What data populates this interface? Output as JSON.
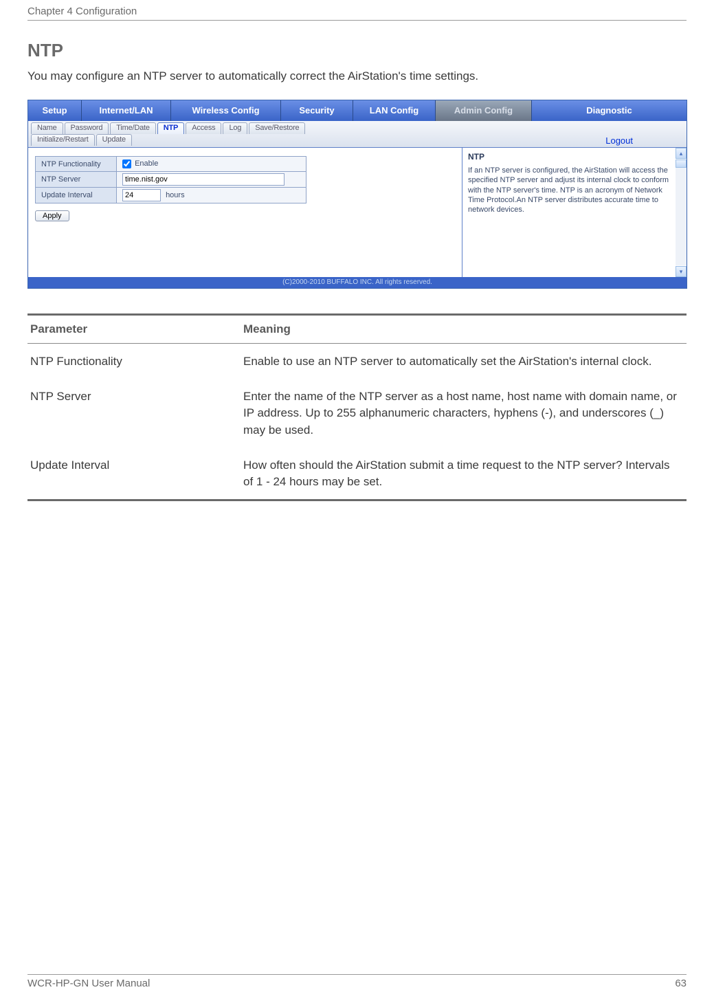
{
  "header": {
    "chapter": "Chapter 4  Configuration"
  },
  "section": {
    "title": "NTP",
    "intro": "You may configure an NTP server to automatically correct the AirStation's time settings."
  },
  "ui": {
    "tabs": {
      "setup": "Setup",
      "internet": "Internet/LAN",
      "wireless": "Wireless Config",
      "security": "Security",
      "lan": "LAN Config",
      "admin": "Admin Config",
      "diag": "Diagnostic"
    },
    "subtabs": {
      "name": "Name",
      "password": "Password",
      "timedate": "Time/Date",
      "ntp": "NTP",
      "access": "Access",
      "log": "Log",
      "saverestore": "Save/Restore",
      "initrestart": "Initialize/Restart",
      "update": "Update"
    },
    "logout": "Logout",
    "form": {
      "functionality_label": "NTP Functionality",
      "enable_label": "Enable",
      "server_label": "NTP Server",
      "server_value": "time.nist.gov",
      "interval_label": "Update Interval",
      "interval_value": "24",
      "interval_unit": "hours",
      "apply": "Apply"
    },
    "help": {
      "title": "NTP",
      "body": "If an NTP server is configured, the AirStation will access the specified NTP server and adjust its internal clock to conform with the NTP server's time. NTP is an acronym of Network Time Protocol.An NTP server distributes accurate time to network devices."
    },
    "copyright": "(C)2000-2010 BUFFALO INC. All rights reserved."
  },
  "param_table": {
    "head_param": "Parameter",
    "head_meaning": "Meaning",
    "rows": [
      {
        "param": "NTP Functionality",
        "meaning": "Enable to use an NTP server to automatically set the AirStation's internal clock."
      },
      {
        "param": "NTP Server",
        "meaning": "Enter the name of the NTP server as a host name, host name with domain name, or IP address. Up to 255 alphanumeric characters, hyphens (-), and underscores (_) may be used."
      },
      {
        "param": "Update Interval",
        "meaning": "How often should the AirStation submit a time request to the NTP server? Intervals of 1 - 24 hours may be set."
      }
    ]
  },
  "footer": {
    "manual": "WCR-HP-GN User Manual",
    "page": "63"
  }
}
